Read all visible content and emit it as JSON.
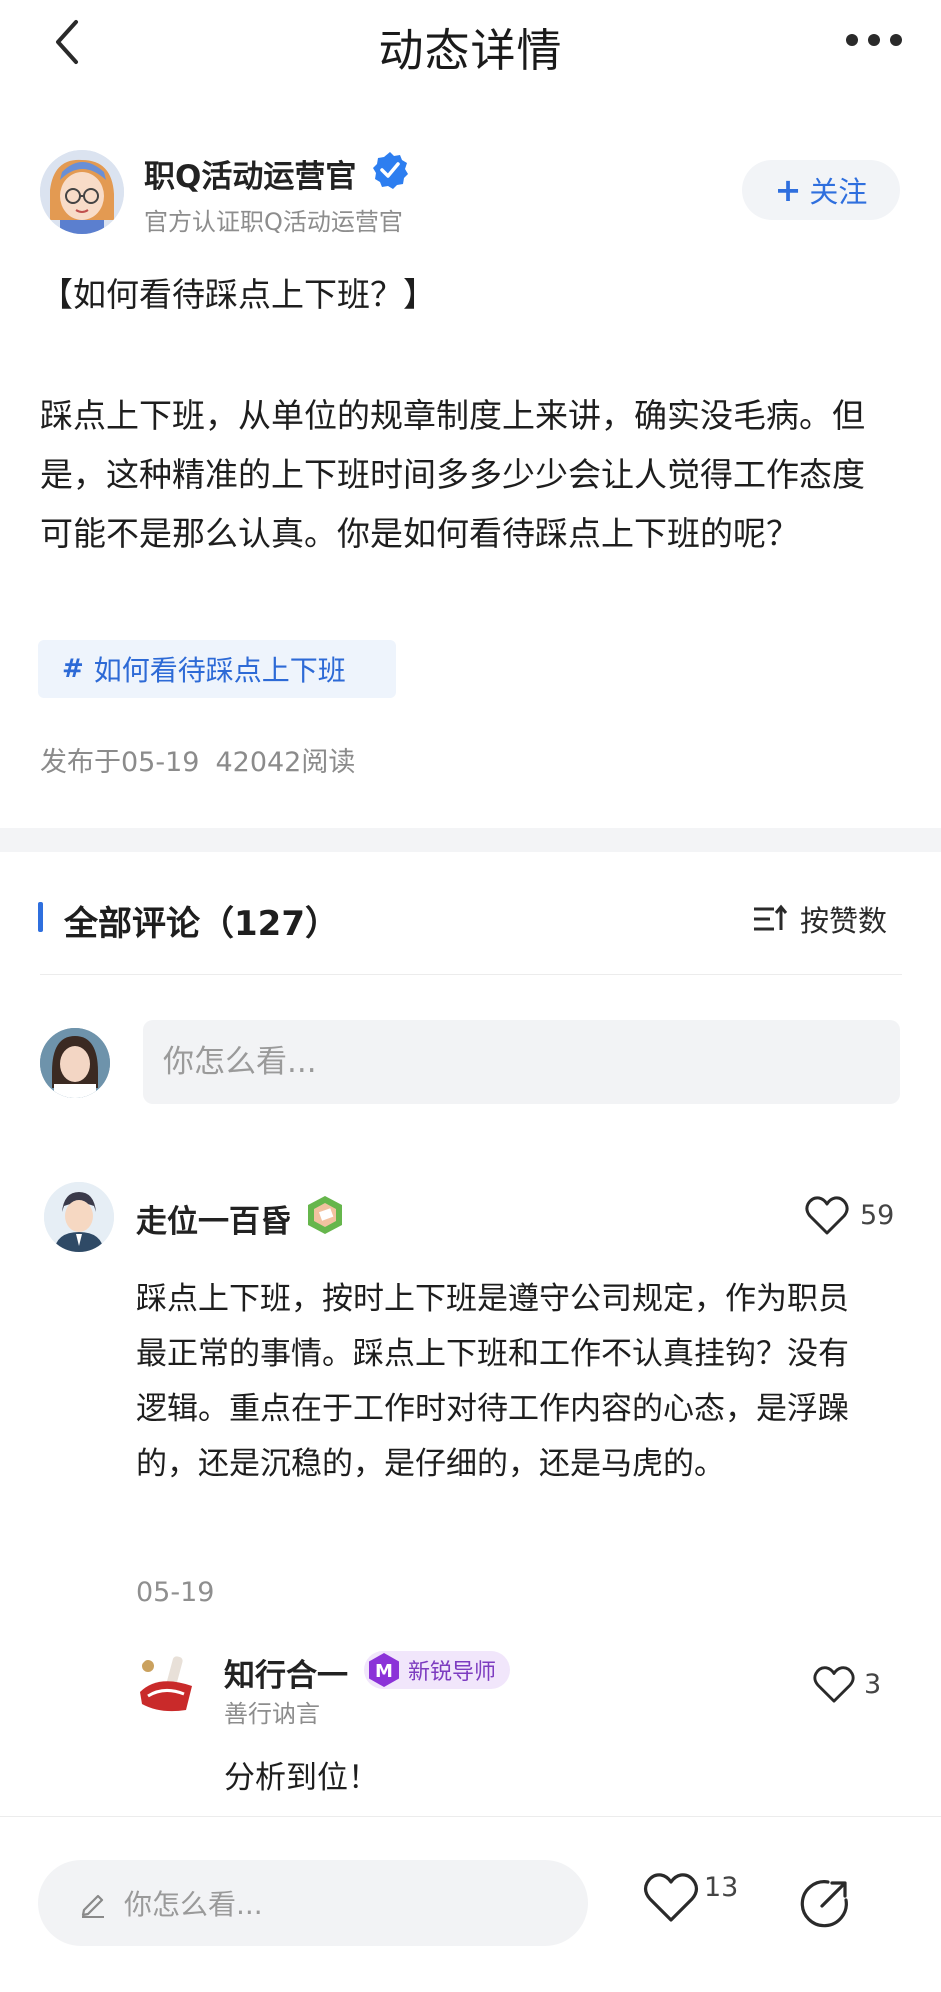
{
  "header": {
    "title": "动态详情"
  },
  "author": {
    "name": "职Q活动运营官",
    "subtitle": "官方认证职Q活动运营官",
    "follow_label": "关注"
  },
  "post": {
    "title": "【如何看待踩点上下班？】",
    "body": "踩点上下班，从单位的规章制度上来讲，确实没毛病。但是，这种精准的上下班时间多多少少会让人觉得工作态度可能不是那么认真。你是如何看待踩点上下班的呢？",
    "topic": "如何看待踩点上下班",
    "published": "发布于05-19",
    "reads": "42042阅读"
  },
  "comments": {
    "title": "全部评论（127）",
    "sort_label": "按赞数",
    "input_placeholder": "你怎么看..."
  },
  "comment_1": {
    "name": "走位一百昏",
    "likes": "59",
    "body": "踩点上下班，按时上下班是遵守公司规定，作为职员最正常的事情。踩点上下班和工作不认真挂钩？没有逻辑。重点在于工作时对待工作内容的心态，是浮躁的，还是沉稳的，是仔细的，还是马虎的。",
    "date": "05-19"
  },
  "reply_1": {
    "name": "知行合一",
    "badge_letter": "M",
    "badge_label": "新锐导师",
    "subtitle": "善行讷言",
    "likes": "3",
    "body": "分析到位！"
  },
  "bottom_bar": {
    "placeholder": "你怎么看...",
    "likes": "13"
  },
  "colors": {
    "accent": "#2f6fde",
    "tag_bg": "#eef4fc",
    "mentor": "#7d3cc0"
  }
}
